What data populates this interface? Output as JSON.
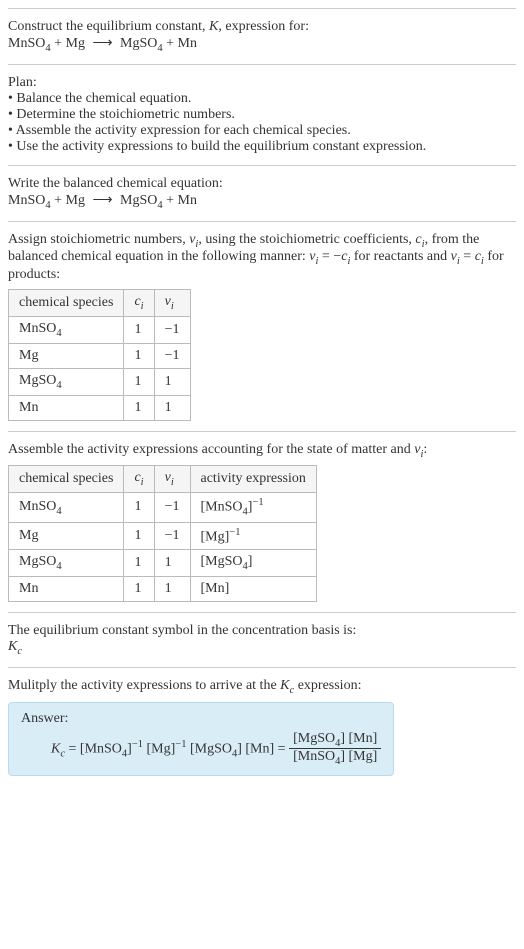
{
  "header": {
    "line1": "Construct the equilibrium constant, ",
    "Ksym": "K",
    "line1b": ", expression for:",
    "eq_lhs_a": "MnSO",
    "eq_lhs_a_sub": "4",
    "eq_lhs_plus": " + Mg ",
    "eq_rhs_a": " MgSO",
    "eq_rhs_a_sub": "4",
    "eq_rhs_plus": " + Mn"
  },
  "plan": {
    "title": "Plan:",
    "b1": "• Balance the chemical equation.",
    "b2": "• Determine the stoichiometric numbers.",
    "b3": "• Assemble the activity expression for each chemical species.",
    "b4": "• Use the activity expressions to build the equilibrium constant expression."
  },
  "balanced": {
    "title": "Write the balanced chemical equation:"
  },
  "stoich": {
    "intro_a": "Assign stoichiometric numbers, ",
    "nu": "ν",
    "sub_i": "i",
    "intro_b": ", using the stoichiometric coefficients, ",
    "c": "c",
    "intro_c": ", from the balanced chemical equation in the following manner: ",
    "eq1": " = −",
    "intro_d": " for reactants and ",
    "eq2": " = ",
    "intro_e": " for products:",
    "table": {
      "h1": "chemical species",
      "h2": "cᵢ",
      "h3": "νᵢ",
      "rows": [
        {
          "sp_a": "MnSO",
          "sp_sub": "4",
          "c": "1",
          "nu": "−1"
        },
        {
          "sp_a": "Mg",
          "sp_sub": "",
          "c": "1",
          "nu": "−1"
        },
        {
          "sp_a": "MgSO",
          "sp_sub": "4",
          "c": "1",
          "nu": "1"
        },
        {
          "sp_a": "Mn",
          "sp_sub": "",
          "c": "1",
          "nu": "1"
        }
      ]
    }
  },
  "activity": {
    "intro_a": "Assemble the activity expressions accounting for the state of matter and ",
    "intro_b": ":",
    "table": {
      "h1": "chemical species",
      "h2": "cᵢ",
      "h3": "νᵢ",
      "h4": "activity expression",
      "rows": [
        {
          "sp_a": "MnSO",
          "sp_sub": "4",
          "c": "1",
          "nu": "−1",
          "ae_a": "[MnSO",
          "ae_sub": "4",
          "ae_b": "]",
          "ae_sup": "−1"
        },
        {
          "sp_a": "Mg",
          "sp_sub": "",
          "c": "1",
          "nu": "−1",
          "ae_a": "[Mg]",
          "ae_sub": "",
          "ae_b": "",
          "ae_sup": "−1"
        },
        {
          "sp_a": "MgSO",
          "sp_sub": "4",
          "c": "1",
          "nu": "1",
          "ae_a": "[MgSO",
          "ae_sub": "4",
          "ae_b": "]",
          "ae_sup": ""
        },
        {
          "sp_a": "Mn",
          "sp_sub": "",
          "c": "1",
          "nu": "1",
          "ae_a": "[Mn]",
          "ae_sub": "",
          "ae_b": "",
          "ae_sup": ""
        }
      ]
    }
  },
  "symbol": {
    "line": "The equilibrium constant symbol in the concentration basis is:",
    "kc": "K",
    "kc_sub": "c"
  },
  "final": {
    "intro_a": "Mulitply the activity expressions to arrive at the ",
    "intro_b": " expression:",
    "answer_label": "Answer:",
    "kc": "K",
    "kc_sub": "c",
    "eq": " = [MnSO",
    "s4": "4",
    "eq2": "]",
    "sup_neg1": "−1",
    "eq3": " [Mg]",
    "eq4": " [MgSO",
    "eq5": "] [Mn] = ",
    "num_a": "[MgSO",
    "num_b": "] [Mn]",
    "den_a": "[MnSO",
    "den_b": "] [Mg]"
  }
}
